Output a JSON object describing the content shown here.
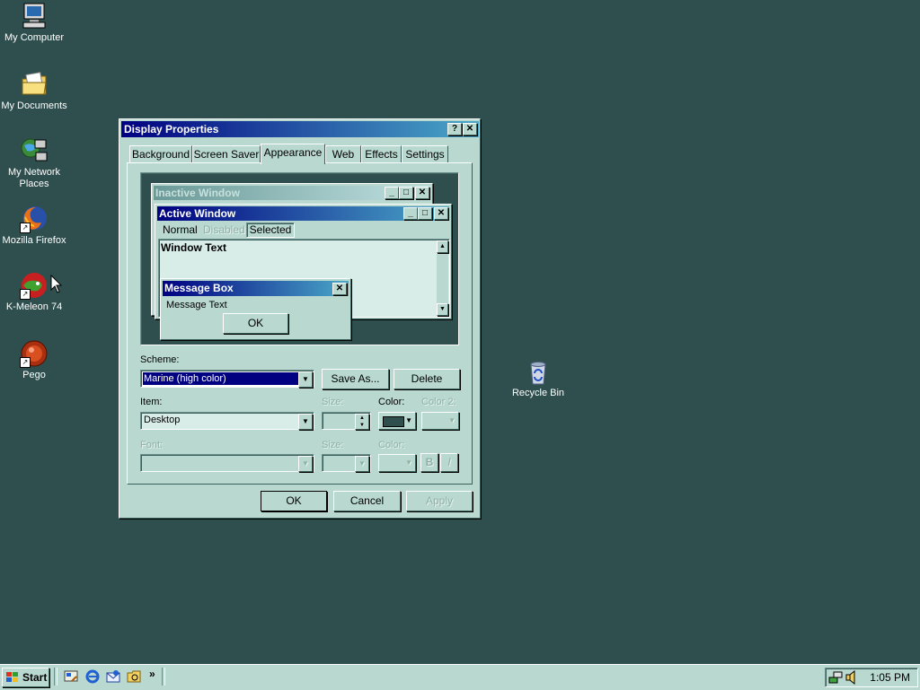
{
  "desktop": {
    "icons": [
      {
        "label": "My Computer",
        "icon": "computer-icon"
      },
      {
        "label": "My Documents",
        "icon": "documents-folder-icon"
      },
      {
        "label": "My Network Places",
        "icon": "network-icon"
      },
      {
        "label": "Mozilla Firefox",
        "icon": "firefox-icon"
      },
      {
        "label": "K-Meleon 74",
        "icon": "kmeleon-icon"
      },
      {
        "label": "Pego",
        "icon": "pego-icon"
      },
      {
        "label": "Recycle Bin",
        "icon": "recycle-bin-icon"
      }
    ]
  },
  "dialog": {
    "title": "Display Properties",
    "help_btn": "?",
    "close_btn": "✕",
    "tabs": [
      "Background",
      "Screen Saver",
      "Appearance",
      "Web",
      "Effects",
      "Settings"
    ],
    "active_tab": "Appearance",
    "preview": {
      "inactive_title": "Inactive Window",
      "active_title": "Active Window",
      "menu_normal": "Normal",
      "menu_disabled": "Disabled",
      "menu_selected": "Selected",
      "window_text": "Window Text",
      "msgbox_title": "Message Box",
      "msgbox_text": "Message Text",
      "msgbox_ok": "OK"
    },
    "scheme_label": "Scheme:",
    "scheme_value": "Marine (high color)",
    "save_as": "Save As...",
    "delete": "Delete",
    "item_label": "Item:",
    "item_value": "Desktop",
    "size_label": "Size:",
    "color_label": "Color:",
    "color2_label": "Color 2:",
    "font_label": "Font:",
    "font_size_label": "Size:",
    "font_color_label": "Color:",
    "bold_btn": "B",
    "italic_btn": "I",
    "ok": "OK",
    "cancel": "Cancel",
    "apply": "Apply",
    "colors": {
      "title_active_start": "#000080",
      "title_active_end": "#4aa8c8",
      "face": "#b8d8d0",
      "desktop": "#2f4f4f",
      "selected_color": "#2f4f4f"
    }
  },
  "taskbar": {
    "start": "Start",
    "quicklaunch": [
      "show-desktop-icon",
      "ie-icon",
      "outlook-icon",
      "explorer-icon"
    ],
    "chevron": "»",
    "clock": "1:05 PM"
  }
}
